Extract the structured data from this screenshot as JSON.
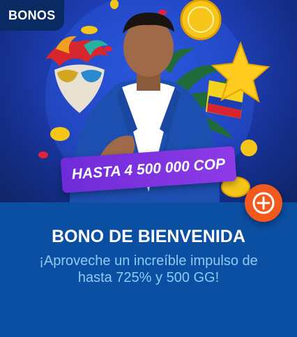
{
  "card": {
    "badge": "BONOS",
    "promo_text": "HASTA 4 500 000 COP",
    "title": "BONO DE BIENVENIDA",
    "subtitle": "¡Aproveche un increíble impulso de hasta 725% y 500 GG!",
    "expand_icon": "plus-circle-icon"
  },
  "colors": {
    "background": "#0b4fa3",
    "badge_bg": "#0a2a63",
    "promo_bg": "#7b2fe0",
    "accent": "#f25a1d",
    "subtitle": "#8fcaf5"
  }
}
